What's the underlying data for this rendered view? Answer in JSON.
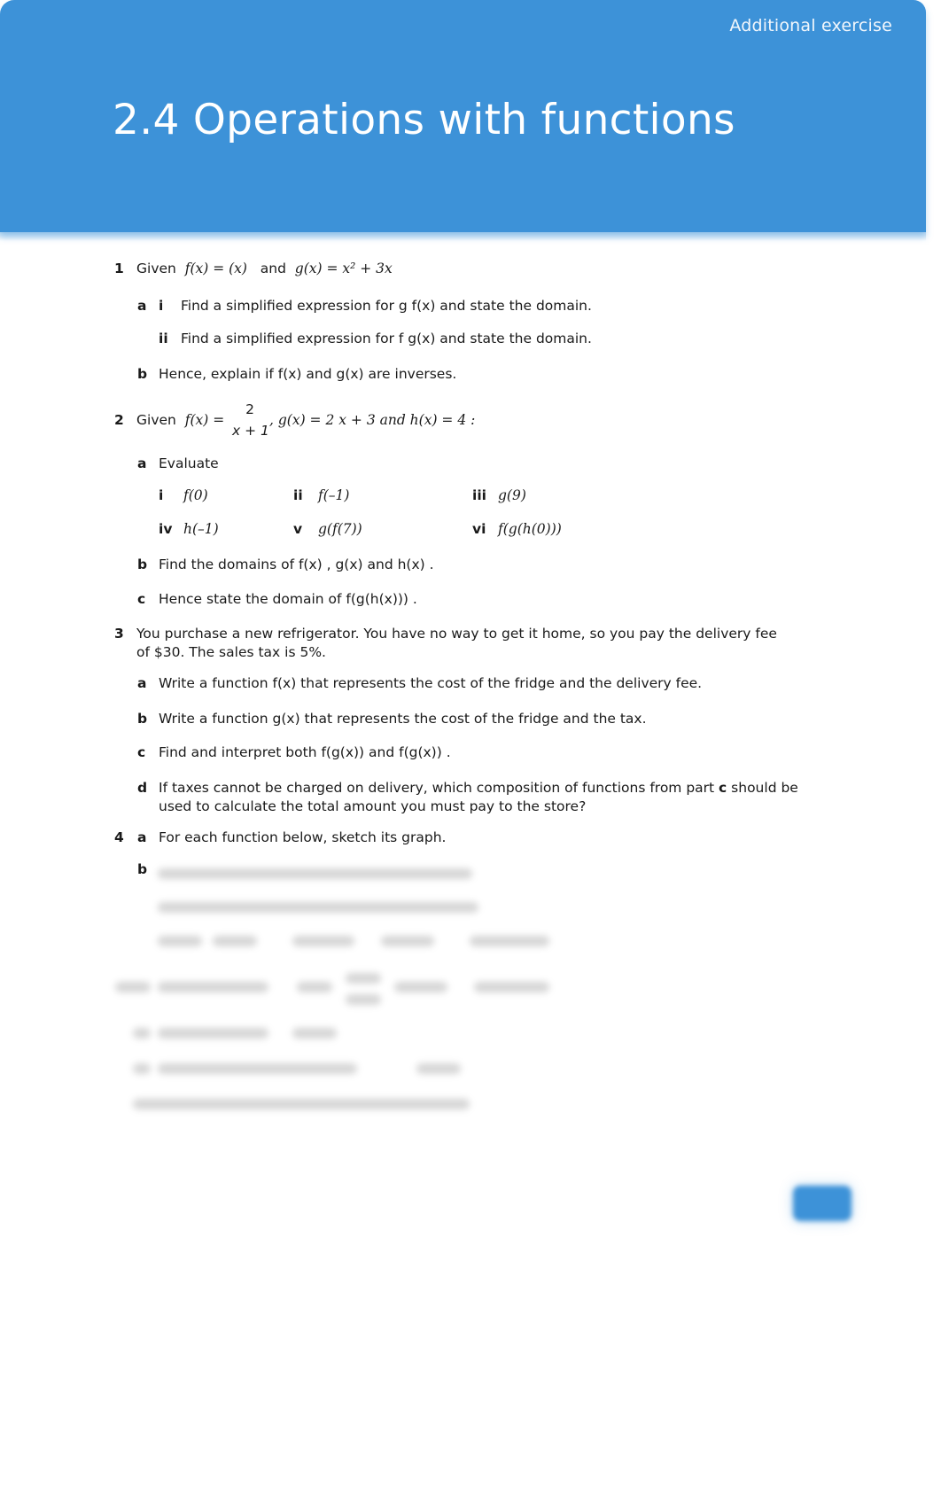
{
  "header": {
    "label": "Additional exercise",
    "title": "2.4 Operations with functions",
    "accent_color": "#3d92d8"
  },
  "questions": {
    "q1": {
      "number": "1",
      "stem_prefix": "Given",
      "f_def": "f(x) =  (x)",
      "and": "and",
      "g_def": "g(x) = x² + 3x",
      "a_label": "a",
      "ai_label": "i",
      "ai_text": "Find a simplified expression for  g   f(x)  and state the domain.",
      "aii_label": "ii",
      "aii_text": "Find a simplified expression for  f   g(x)  and state the domain.",
      "b_label": "b",
      "b_text": "Hence, explain if  f(x)  and  g(x)  are inverses."
    },
    "q2": {
      "number": "2",
      "stem_prefix": "Given",
      "f_lhs": "f(x) =",
      "f_num": "2",
      "f_den": "x + 1",
      "rest": ",  g(x) = 2   x + 3  and  h(x) = 4 :",
      "a_label": "a",
      "a_text": "Evaluate",
      "eval_items": [
        {
          "label": "i",
          "expr": "f(0)"
        },
        {
          "label": "ii",
          "expr": "f(–1)"
        },
        {
          "label": "iii",
          "expr": "g(9)"
        },
        {
          "label": "iv",
          "expr": "h(–1)"
        },
        {
          "label": "v",
          "expr": "g(f(7))"
        },
        {
          "label": "vi",
          "expr": "f(g(h(0)))"
        }
      ],
      "b_label": "b",
      "b_text": "Find the domains of  f(x) ,  g(x)  and  h(x) .",
      "c_label": "c",
      "c_text": "Hence state the domain of  f(g(h(x))) ."
    },
    "q3": {
      "number": "3",
      "stem_line1": "You purchase a new refrigerator. You have no way to get it home, so you pay the delivery fee",
      "stem_line2": "of $30. The sales tax is 5%.",
      "a_label": "a",
      "a_text": "Write a function  f(x)  that represents the cost of the fridge and the delivery fee.",
      "b_label": "b",
      "b_text": "Write a function  g(x)  that represents the cost of the fridge and the tax.",
      "c_label": "c",
      "c_text": "Find and interpret both  f(g(x))  and  f(g(x)) .",
      "d_label": "d",
      "d_line1_pre": "If taxes cannot be charged on delivery, which composition of functions from part ",
      "d_line1_bold": "c",
      "d_line1_post": " should be",
      "d_line2": "used to calculate the total amount you must pay to the store?"
    },
    "q4": {
      "number": "4",
      "a_label": "a",
      "a_text": "For each function below, sketch its graph.",
      "b_label": "b"
    }
  }
}
